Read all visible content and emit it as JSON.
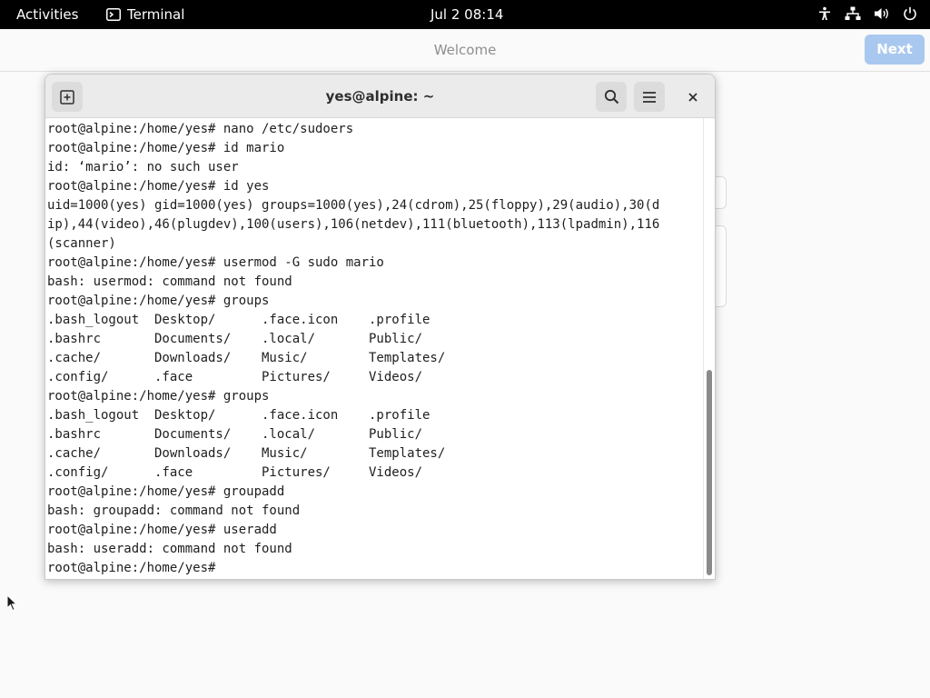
{
  "topbar": {
    "activities": "Activities",
    "app_name": "Terminal",
    "clock": "Jul 2  08:14"
  },
  "welcome": {
    "title": "Welcome",
    "next_label": "Next"
  },
  "terminal": {
    "title": "yes@alpine: ~",
    "lines": [
      "root@alpine:/home/yes# nano /etc/sudoers",
      "root@alpine:/home/yes# id mario",
      "id: ‘mario’: no such user",
      "root@alpine:/home/yes# id yes",
      "uid=1000(yes) gid=1000(yes) groups=1000(yes),24(cdrom),25(floppy),29(audio),30(d",
      "ip),44(video),46(plugdev),100(users),106(netdev),111(bluetooth),113(lpadmin),116",
      "(scanner)",
      "root@alpine:/home/yes# usermod -G sudo mario",
      "bash: usermod: command not found",
      "root@alpine:/home/yes# groups",
      ".bash_logout  Desktop/      .face.icon    .profile",
      ".bashrc       Documents/    .local/       Public/",
      ".cache/       Downloads/    Music/        Templates/",
      ".config/      .face         Pictures/     Videos/",
      "root@alpine:/home/yes# groups",
      ".bash_logout  Desktop/      .face.icon    .profile",
      ".bashrc       Documents/    .local/       Public/",
      ".cache/       Downloads/    Music/        Templates/",
      ".config/      .face         Pictures/     Videos/",
      "root@alpine:/home/yes# groupadd",
      "bash: groupadd: command not found",
      "root@alpine:/home/yes# useradd",
      "bash: useradd: command not found",
      "root@alpine:/home/yes# "
    ]
  }
}
